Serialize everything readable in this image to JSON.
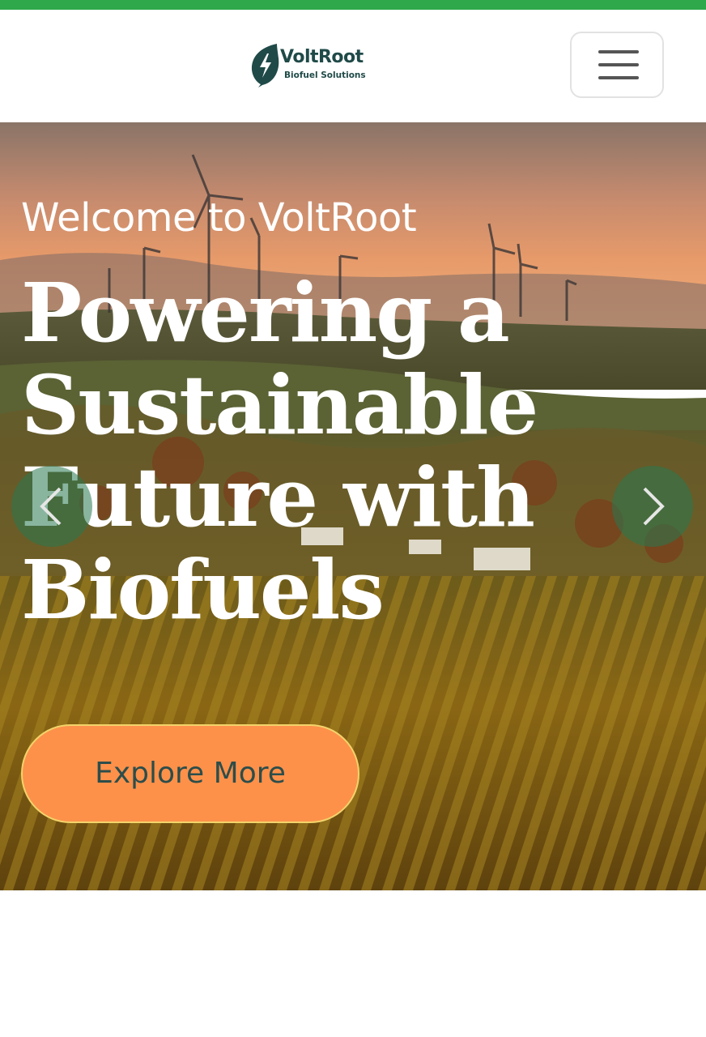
{
  "status_bar": {
    "color": "#2ea84a"
  },
  "header": {
    "logo": {
      "name": "VoltRoot",
      "tagline": "Biofuel Solutions",
      "icon": "leaf-bolt-icon",
      "brand_color": "#1f4a48"
    },
    "menu_button": {
      "icon": "hamburger-menu-icon"
    }
  },
  "hero": {
    "welcome": "Welcome to VoltRoot",
    "headline": "Powering a Sustainable Future with Biofuels",
    "cta_label": "Explore More",
    "cta_color": "#fd914a",
    "prev_icon": "chevron-left-icon",
    "next_icon": "chevron-right-icon",
    "background": "sunset-vineyard-wind-turbines-photo"
  }
}
